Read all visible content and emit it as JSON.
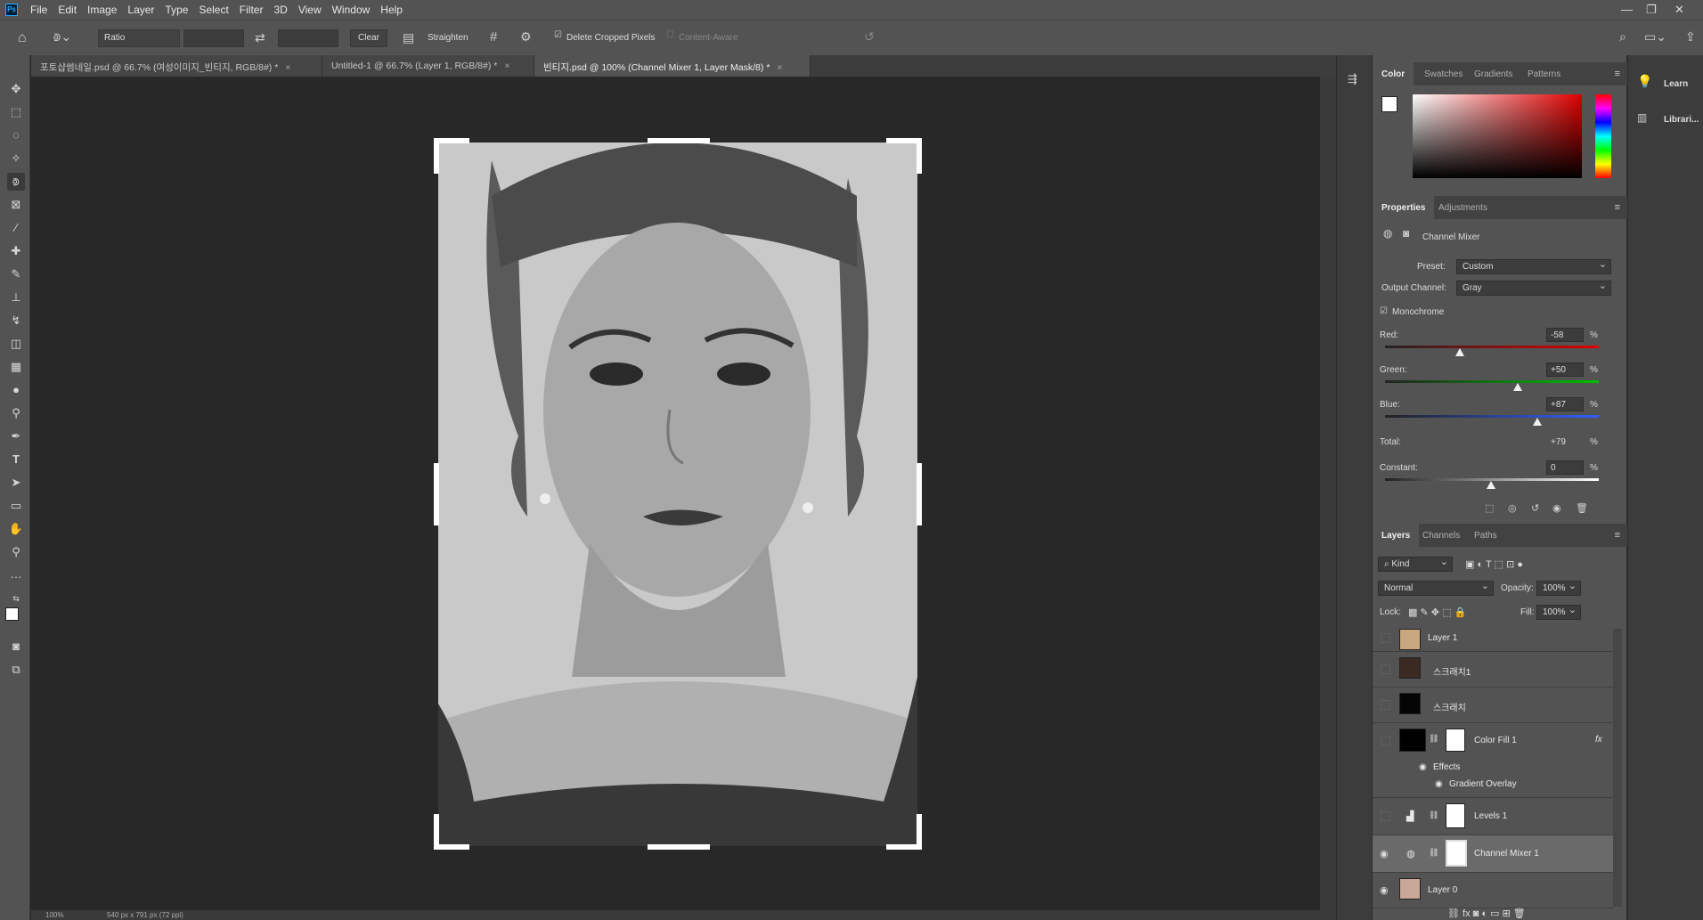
{
  "menu": [
    "File",
    "Edit",
    "Image",
    "Layer",
    "Type",
    "Select",
    "Filter",
    "3D",
    "View",
    "Window",
    "Help"
  ],
  "app_logo": "Ps",
  "options": {
    "ratio": "Ratio",
    "clear": "Clear",
    "straighten": "Straighten",
    "delete_cropped": "Delete Cropped Pixels",
    "content_aware": "Content-Aware"
  },
  "tabs": [
    {
      "label": "포토샵썸네일.psd @ 66.7% (여성이미지_빈티지, RGB/8#) *"
    },
    {
      "label": "Untitled-1 @ 66.7% (Layer 1, RGB/8#) *"
    },
    {
      "label": "빈티지.psd @ 100% (Channel Mixer 1, Layer Mask/8) *"
    }
  ],
  "status": {
    "zoom": "100%",
    "doc": "540 px x 791 px (72 ppi)"
  },
  "color_panel": {
    "tabs": [
      "Color",
      "Swatches",
      "Gradients",
      "Patterns"
    ]
  },
  "right_col": {
    "learn": "Learn",
    "libraries": "Librari..."
  },
  "properties": {
    "tabs": [
      "Properties",
      "Adjustments"
    ],
    "title": "Channel Mixer",
    "preset_label": "Preset:",
    "preset_value": "Custom",
    "output_label": "Output Channel:",
    "output_value": "Gray",
    "monochrome": "Monochrome",
    "red_label": "Red:",
    "red_value": "-58",
    "green_label": "Green:",
    "green_value": "+50",
    "blue_label": "Blue:",
    "blue_value": "+87",
    "total_label": "Total:",
    "total_value": "+79",
    "constant_label": "Constant:",
    "constant_value": "0",
    "pct": "%"
  },
  "layers_panel": {
    "tabs": [
      "Layers",
      "Channels",
      "Paths"
    ],
    "kind": "Kind",
    "blend_mode": "Normal",
    "opacity_label": "Opacity:",
    "opacity_value": "100%",
    "lock_label": "Lock:",
    "fill_label": "Fill:",
    "fill_value": "100%",
    "layers": [
      {
        "name": "Layer 1"
      },
      {
        "name": "스크래치1"
      },
      {
        "name": "스크래치"
      },
      {
        "name": "Color Fill 1",
        "effects": "Effects",
        "effect_item": "Gradient Overlay"
      },
      {
        "name": "Levels 1"
      },
      {
        "name": "Channel Mixer 1"
      },
      {
        "name": "Layer 0"
      }
    ]
  },
  "colors": {
    "accent": "#31a8ff",
    "panel": "#535353",
    "canvas": "#282828"
  }
}
